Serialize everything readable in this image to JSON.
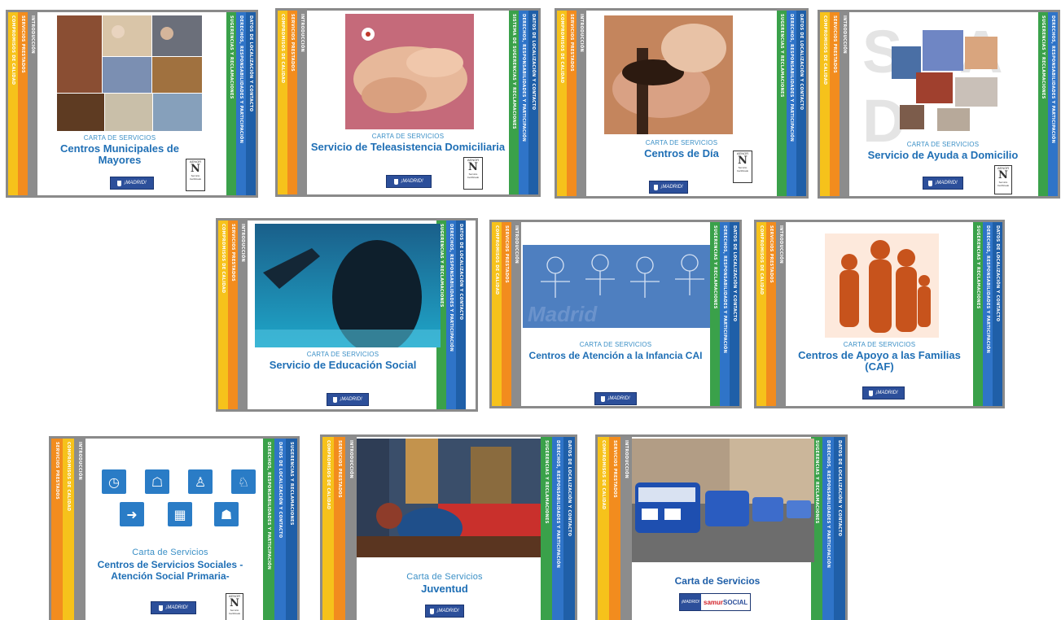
{
  "colors": {
    "yellow": "#f6c21b",
    "orange": "#f28c1e",
    "gray": "#8c8c8c",
    "green": "#3aa14a",
    "blue": "#2f74c8",
    "title_blue": "#1f6fb5",
    "madrid_blue": "#2c4f9a"
  },
  "stripes": {
    "compromisos": "COMPROMISOS DE CALIDAD",
    "servicios": "SERVICIOS PRESTADOS",
    "introduccion": "INTRODUCCIÓN",
    "sugerencias": "SUGERENCIAS Y RECLAMACIONES",
    "derechos": "DERECHOS, RESPONSABILIDADES Y PARTICIPACIÓN",
    "datos": "DATOS DE LOCALIZACIÓN Y CONTACTO",
    "sistema": "SISTEMA DE SUGERENCIAS Y RECLAMACIONES"
  },
  "logos": {
    "madrid": "¡MADRID!",
    "aenor_top": "AENOR",
    "aenor_mark": "N",
    "aenor_bottom": "Servicio Certificado",
    "samur_prefix": "samur",
    "samur_suffix": "SOCIAL"
  },
  "cards": [
    {
      "subtitle": "CARTA DE SERVICIOS",
      "title": "Centros Municipales de Mayores"
    },
    {
      "subtitle": "CARTA DE SERVICIOS",
      "title": "Servicio de Teleasistencia Domiciliaria"
    },
    {
      "subtitle": "CARTA DE SERVICIOS",
      "title": "Centros de Día"
    },
    {
      "subtitle": "CARTA DE SERVICIOS",
      "title": "Servicio de Ayuda a Domicilio",
      "bg_text": "S A D"
    },
    {
      "subtitle": "CARTA DE SERVICIOS",
      "title": "Servicio de Educación Social"
    },
    {
      "subtitle": "CARTA DE SERVICIOS",
      "title": "Centros de Atención a la Infancia CAI",
      "bg_text": "Madrid"
    },
    {
      "subtitle": "CARTA DE SERVICIOS",
      "title": "Centros de Apoyo a las Familias (CAF)"
    },
    {
      "subtitle": "Carta de Servicios",
      "title": "Centros de Servicios Sociales -Atención Social Primaria-"
    },
    {
      "subtitle": "Carta de Servicios",
      "title": "Juventud"
    },
    {
      "subtitle": "Carta de Servicios",
      "title": ""
    }
  ]
}
